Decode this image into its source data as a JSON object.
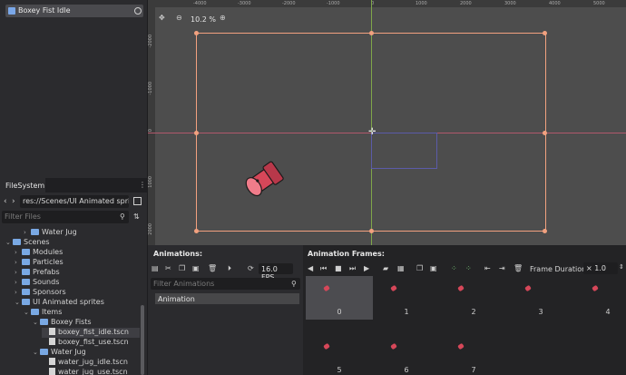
{
  "scene": {
    "node_name": "Boxey Fist Idle"
  },
  "filesystem": {
    "tab": "FileSystem",
    "path": "res://Scenes/UI Animated sprites/",
    "filter_placeholder": "Filter Files",
    "tree": [
      {
        "label": "Water Jug",
        "depth": 2,
        "type": "folder",
        "expanded": false
      },
      {
        "label": "Scenes",
        "depth": 0,
        "type": "folder",
        "expanded": true
      },
      {
        "label": "Modules",
        "depth": 1,
        "type": "folder",
        "expanded": false
      },
      {
        "label": "Particles",
        "depth": 1,
        "type": "folder",
        "expanded": false
      },
      {
        "label": "Prefabs",
        "depth": 1,
        "type": "folder",
        "expanded": false
      },
      {
        "label": "Sounds",
        "depth": 1,
        "type": "folder",
        "expanded": false
      },
      {
        "label": "Sponsors",
        "depth": 1,
        "type": "folder",
        "expanded": false
      },
      {
        "label": "UI Animated sprites",
        "depth": 1,
        "type": "folder",
        "expanded": true
      },
      {
        "label": "Items",
        "depth": 2,
        "type": "folder",
        "expanded": true
      },
      {
        "label": "Boxey Fists",
        "depth": 3,
        "type": "folder",
        "expanded": true
      },
      {
        "label": "boxey_fist_idle.tscn",
        "depth": 4,
        "type": "file",
        "selected": true
      },
      {
        "label": "boxey_fist_use.tscn",
        "depth": 4,
        "type": "file"
      },
      {
        "label": "Water Jug",
        "depth": 3,
        "type": "folder",
        "expanded": true
      },
      {
        "label": "water_jug_idle.tscn",
        "depth": 4,
        "type": "file"
      },
      {
        "label": "water_jug_use.tscn",
        "depth": 4,
        "type": "file"
      }
    ]
  },
  "viewport": {
    "zoom": "10.2 %",
    "ruler_top": [
      "-4000",
      "-3000",
      "-2000",
      "-1000",
      "0",
      "1000",
      "2000",
      "3000",
      "4000",
      "5000"
    ],
    "ruler_left": [
      "-2000",
      "-1000",
      "0",
      "1000",
      "2000"
    ]
  },
  "animations": {
    "title": "Animations:",
    "fps": "16.0 FPS",
    "filter_placeholder": "Filter Animations",
    "items": [
      "Animation"
    ]
  },
  "frames": {
    "title": "Animation Frames:",
    "duration_label": "Frame Duration:",
    "duration_value": "× 1.0",
    "cells": [
      "0",
      "1",
      "2",
      "3",
      "4",
      "5",
      "6",
      "7"
    ]
  },
  "colors": {
    "accent": "#f2a17f",
    "fist": "#d64759",
    "folder": "#79a8e3"
  }
}
